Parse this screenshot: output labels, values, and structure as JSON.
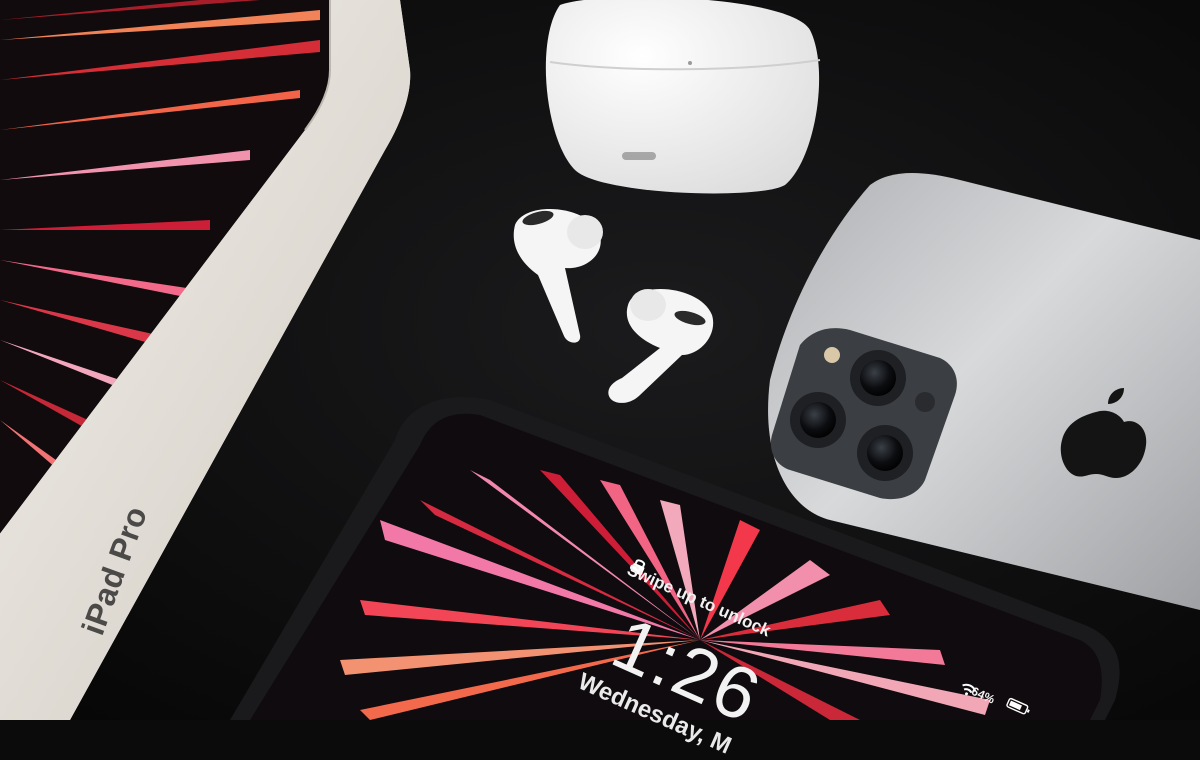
{
  "ipad_box": {
    "brand_label": "iPad Pro"
  },
  "ipad_lock_screen": {
    "unlock_prompt": "Swipe up to unlock",
    "time": "1:26",
    "date": "Wednesday, M",
    "battery": "64%"
  },
  "colors": {
    "background": "#0b0b0c",
    "box_white": "#e9e5df",
    "wallpaper_red": "#e23a3a",
    "wallpaper_pink": "#ff7fb0",
    "phone_silver": "#c8c9cb",
    "airpods_white": "#f3f3f3"
  }
}
